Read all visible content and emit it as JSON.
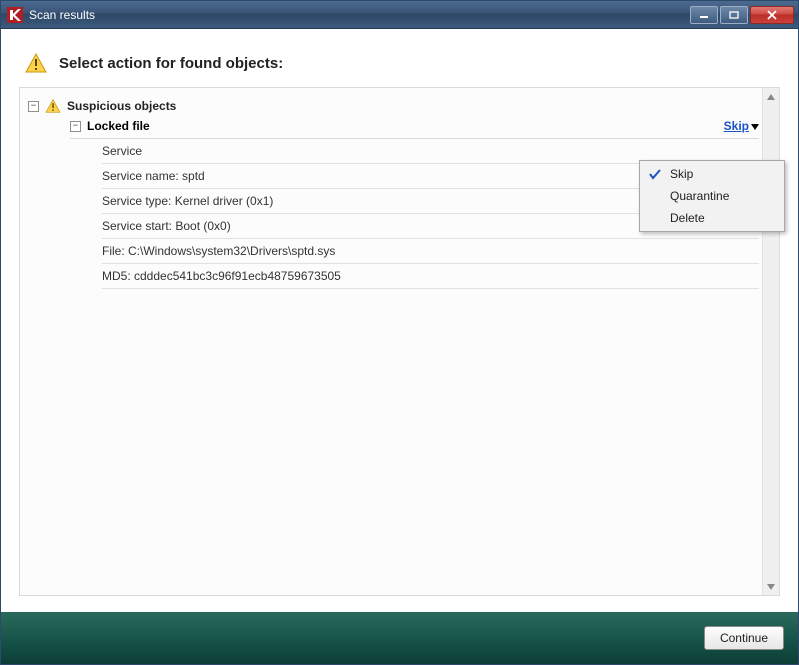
{
  "window": {
    "title": "Scan results"
  },
  "header": {
    "title": "Select action for found objects:"
  },
  "tree": {
    "group_label": "Suspicious objects",
    "item": {
      "label": "Locked file",
      "action_label": "Skip",
      "details": [
        "Service",
        "Service name: sptd",
        "Service type: Kernel driver (0x1)",
        "Service start: Boot (0x0)",
        "File: C:\\Windows\\system32\\Drivers\\sptd.sys",
        "MD5: cdddec541bc3c96f91ecb48759673505"
      ]
    }
  },
  "dropdown": {
    "items": [
      {
        "label": "Skip",
        "checked": true
      },
      {
        "label": "Quarantine",
        "checked": false
      },
      {
        "label": "Delete",
        "checked": false
      }
    ]
  },
  "footer": {
    "continue_label": "Continue"
  }
}
